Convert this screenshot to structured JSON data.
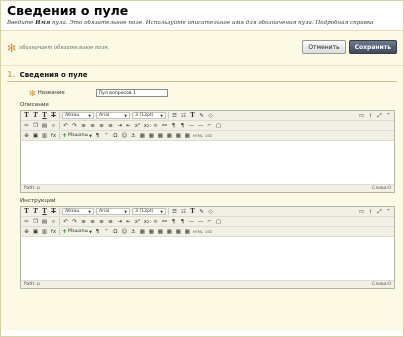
{
  "header": {
    "title": "Сведения о пуле",
    "instructions_pre": "Введите ",
    "instructions_bold": "Имя",
    "instructions_post": " пула. Это обязательное поле. Используйте описательное имя для обозначения пула. Подробная справка"
  },
  "topbar": {
    "required_note": "обозначает обязательное поле.",
    "cancel_label": "Отменить",
    "submit_label": "Сохранить"
  },
  "section": {
    "number": "1.",
    "title": "Сведения о пуле",
    "name_label": "Название",
    "name_value": "Пул вопросов 1"
  },
  "editors": [
    {
      "label": "Описание",
      "paragraph_select": "Абзац",
      "font_select": "Arial",
      "size_select": "3 (12pt)",
      "mashups_label": "Мэшапы",
      "html_label": "HTML",
      "css_label": "CSS",
      "path_label": "Path: p",
      "word_count": "Слова:0"
    },
    {
      "label": "Инструкции",
      "paragraph_select": "Абзац",
      "font_select": "Arial",
      "size_select": "3 (12pt)",
      "mashups_label": "Мэшапы",
      "html_label": "HTML",
      "css_label": "CSS",
      "path_label": "Path: p",
      "word_count": "Слова:0"
    }
  ],
  "toolbar_glyphs": {
    "bold": "T",
    "italic": "T",
    "underline": "T",
    "strike": "T",
    "text_color": "T",
    "paragraph": "¶",
    "omega": "Ω",
    "fx": "fx"
  },
  "colors": {
    "accent": "#e08e2d",
    "panel_bg": "#fcfae4",
    "primary_btn": "#3f4b5b"
  }
}
